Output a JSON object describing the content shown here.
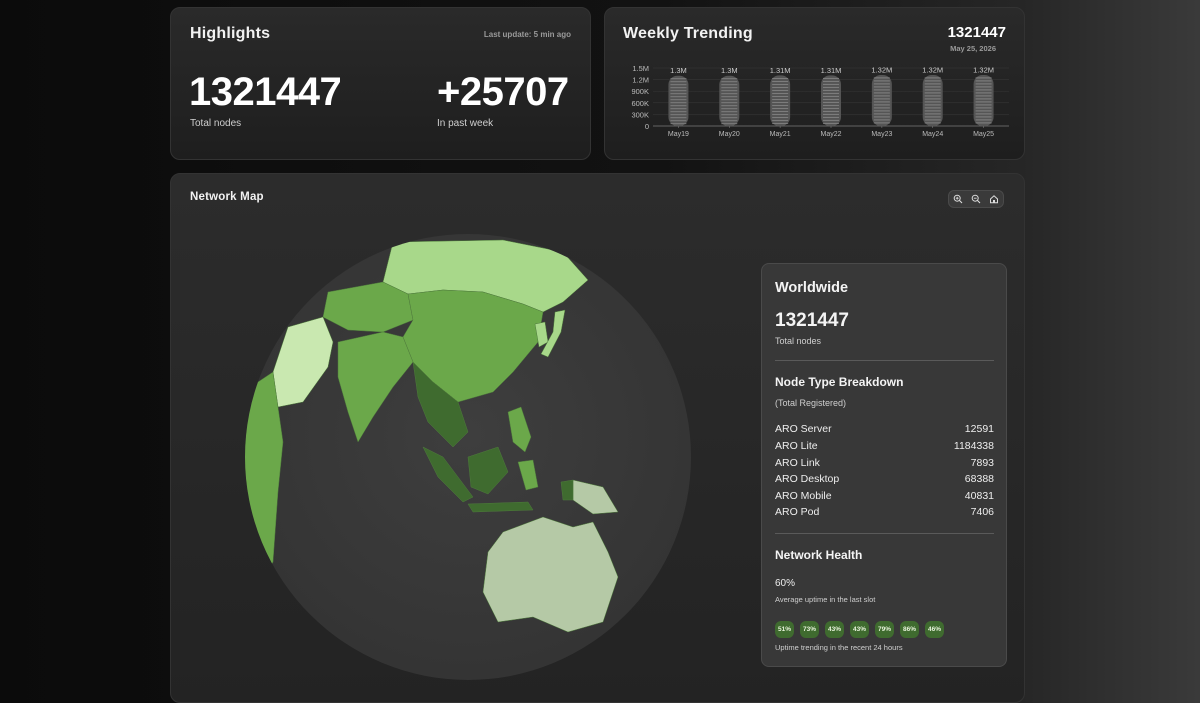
{
  "highlights": {
    "title": "Highlights",
    "last_update": "Last update: 5 min ago",
    "total_nodes": "1321447",
    "total_nodes_label": "Total nodes",
    "past_week": "+25707",
    "past_week_label": "In past week"
  },
  "trending": {
    "title": "Weekly Trending",
    "value": "1321447",
    "date": "May 25, 2026"
  },
  "chart_data": {
    "type": "bar",
    "categories": [
      "May19",
      "May20",
      "May21",
      "May22",
      "May23",
      "May24",
      "May25"
    ],
    "values": [
      1300000,
      1300000,
      1310000,
      1310000,
      1320000,
      1320000,
      1320000
    ],
    "value_labels": [
      "1.3M",
      "1.3M",
      "1.31M",
      "1.31M",
      "1.32M",
      "1.32M",
      "1.32M"
    ],
    "y_ticks": [
      "0",
      "300K",
      "600K",
      "900K",
      "1.2M",
      "1.5M"
    ],
    "ylim": [
      0,
      1500000
    ],
    "grid": true
  },
  "network": {
    "title": "Network Map",
    "zoom_in_icon": "zoom-in-icon",
    "zoom_out_icon": "zoom-out-icon",
    "home_icon": "home-icon"
  },
  "worldwide": {
    "title": "Worldwide",
    "total": "1321447",
    "total_label": "Total nodes",
    "breakdown_title": "Node Type Breakdown",
    "breakdown_sub": "(Total Registered)",
    "types": [
      {
        "name": "ARO Server",
        "count": "12591"
      },
      {
        "name": "ARO Lite",
        "count": "1184338"
      },
      {
        "name": "ARO Link",
        "count": "7893"
      },
      {
        "name": "ARO Desktop",
        "count": "68388"
      },
      {
        "name": "ARO Mobile",
        "count": "40831"
      },
      {
        "name": "ARO Pod",
        "count": "7406"
      }
    ],
    "health_title": "Network Health",
    "health_value": "60%",
    "health_label": "Average uptime in the last slot",
    "uptime": [
      "51%",
      "73%",
      "43%",
      "43%",
      "79%",
      "86%",
      "46%"
    ],
    "uptime_label": "Uptime trending in the recent 24 hours"
  },
  "colors": {
    "accent_green": "#3f6b2f",
    "land_light": "#a8d88a",
    "land_mid": "#6ba84a",
    "land_dark": "#3f6b2f",
    "land_pale": "#b5c9a6",
    "ocean": "#3a3a3a"
  }
}
